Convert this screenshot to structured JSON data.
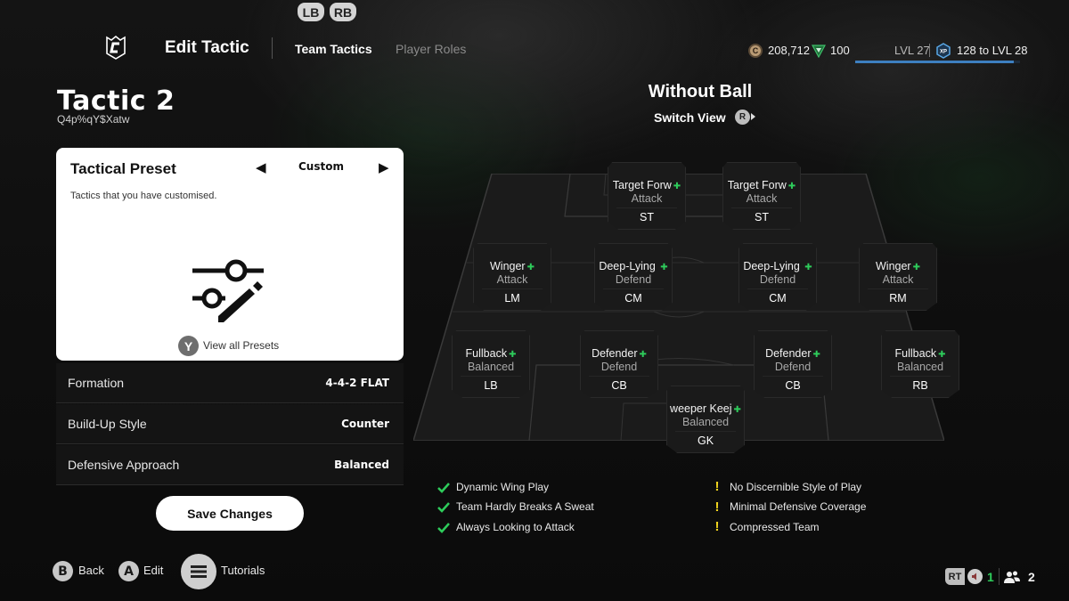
{
  "bumpers": {
    "left": "LB",
    "right": "RB"
  },
  "header": {
    "title": "Edit Tactic",
    "tabs": [
      {
        "label": "Team Tactics",
        "active": true
      },
      {
        "label": "Player Roles",
        "active": false
      }
    ]
  },
  "currency": {
    "coins": "208,712",
    "points": "100",
    "level": "LVL 27",
    "xp_icon_label": "XP",
    "xp_to_next": "128 to LVL 28",
    "xp_progress_percent": 96,
    "accent": "#3d7fc0"
  },
  "tactic": {
    "name": "Tactic 2",
    "code": "Q4p%qY$Xatw"
  },
  "preset": {
    "title": "Tactical Preset",
    "value": "Custom",
    "description": "Tactics that you have customised.",
    "view_all_button": "Y",
    "view_all_label": "View all Presets"
  },
  "settings": [
    {
      "label": "Formation",
      "value": "4-4-2 FLAT"
    },
    {
      "label": "Build-Up Style",
      "value": "Counter"
    },
    {
      "label": "Defensive Approach",
      "value": "Balanced"
    }
  ],
  "save_label": "Save Changes",
  "footer": {
    "back_button": "B",
    "back_label": "Back",
    "edit_button": "A",
    "edit_label": "Edit",
    "tutorials_label": "Tutorials"
  },
  "view": {
    "title": "Without Ball",
    "switch_label": "Switch View",
    "switch_button": "R"
  },
  "players": [
    {
      "role": "Target Forw",
      "duty": "Attack",
      "pos": "ST"
    },
    {
      "role": "Target Forw",
      "duty": "Attack",
      "pos": "ST"
    },
    {
      "role": "Winger",
      "duty": "Attack",
      "pos": "LM"
    },
    {
      "role": "Deep-Lying ",
      "duty": "Defend",
      "pos": "CM"
    },
    {
      "role": "Deep-Lying ",
      "duty": "Defend",
      "pos": "CM"
    },
    {
      "role": "Winger",
      "duty": "Attack",
      "pos": "RM"
    },
    {
      "role": "Fullback",
      "duty": "Balanced",
      "pos": "LB"
    },
    {
      "role": "Defender",
      "duty": "Defend",
      "pos": "CB"
    },
    {
      "role": "Defender",
      "duty": "Defend",
      "pos": "CB"
    },
    {
      "role": "Fullback",
      "duty": "Balanced",
      "pos": "RB"
    },
    {
      "role": "weeper Keej",
      "duty": "Balanced",
      "pos": "GK"
    }
  ],
  "strengths": [
    "Dynamic Wing Play",
    "Team Hardly Breaks A Sweat",
    "Always Looking to Attack"
  ],
  "weaknesses": [
    "No Discernible Style of Play",
    "Minimal Defensive Coverage",
    "Compressed Team"
  ],
  "status": {
    "rt_label": "RT",
    "voice_count": "1",
    "party_count": "2",
    "green": "#2ecc5b",
    "warning": "#f2d51e"
  }
}
